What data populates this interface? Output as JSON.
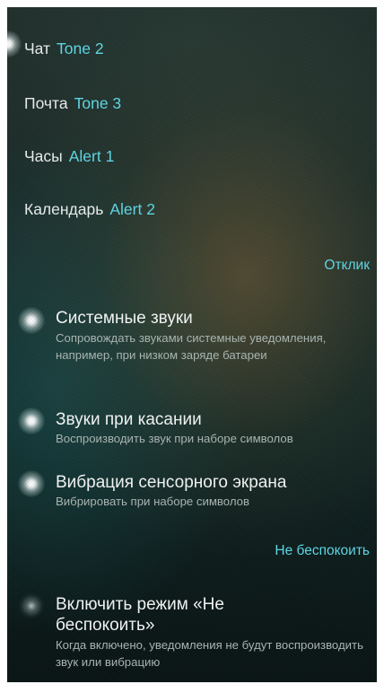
{
  "ringtones": [
    {
      "label": "Чат",
      "value": "Tone 2"
    },
    {
      "label": "Почта",
      "value": "Tone 3"
    },
    {
      "label": "Часы",
      "value": "Alert 1"
    },
    {
      "label": "Календарь",
      "value": "Alert 2"
    }
  ],
  "feedback_section": {
    "header": "Отклик",
    "items": [
      {
        "title": "Системные звуки",
        "description": "Сопровождать звуками системные уведомления, например, при низком заряде батареи",
        "enabled": true,
        "indicator_icon": "glow-dot-icon"
      },
      {
        "title": "Звуки при касании",
        "description": "Воспроизводить звук при наборе символов",
        "enabled": true,
        "indicator_icon": "glow-dot-icon"
      },
      {
        "title": "Вибрация сенсорного экрана",
        "description": "Вибрировать при наборе символов",
        "enabled": true,
        "indicator_icon": "glow-dot-icon"
      }
    ]
  },
  "dnd_section": {
    "header": "Не беспокоить",
    "items": [
      {
        "title": "Включить режим «Не беспокоить»",
        "description": "Когда включено, уведомления не будут воспроизводить звук или вибрацию",
        "enabled": false,
        "indicator_icon": "glow-dot-icon"
      }
    ]
  },
  "colors": {
    "accent": "#5fd8e6",
    "primary_text": "#f2f5f4",
    "secondary_text": "#aab6b3"
  }
}
